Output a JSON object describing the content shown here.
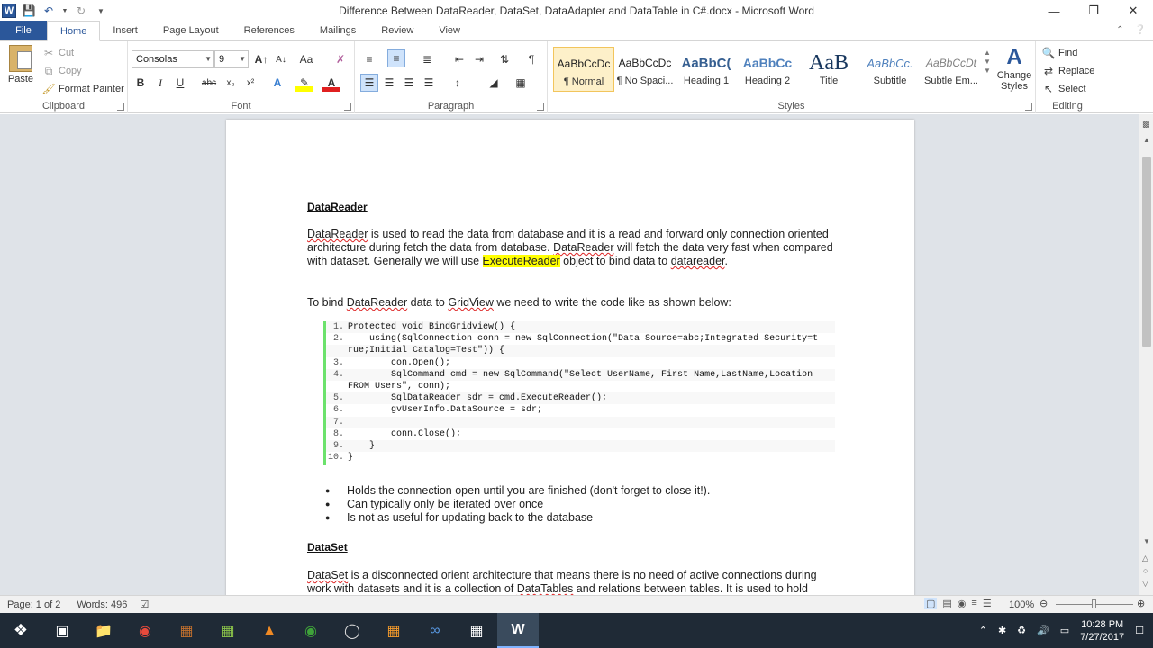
{
  "window": {
    "title": "Difference Between DataReader, DataSet, DataAdapter and DataTable in C#.docx - Microsoft Word"
  },
  "tabs": [
    {
      "label": "File"
    },
    {
      "label": "Home"
    },
    {
      "label": "Insert"
    },
    {
      "label": "Page Layout"
    },
    {
      "label": "References"
    },
    {
      "label": "Mailings"
    },
    {
      "label": "Review"
    },
    {
      "label": "View"
    }
  ],
  "clipboard": {
    "paste": "Paste",
    "cut": "Cut",
    "copy": "Copy",
    "format_painter": "Format Painter",
    "label": "Clipboard"
  },
  "font": {
    "family": "Consolas",
    "size": "9",
    "label": "Font"
  },
  "paragraph": {
    "label": "Paragraph"
  },
  "styles": {
    "items": [
      {
        "preview": "AaBbCcDc",
        "name": "¶ Normal"
      },
      {
        "preview": "AaBbCcDc",
        "name": "¶ No Spaci..."
      },
      {
        "preview": "AaBbC(",
        "name": "Heading 1"
      },
      {
        "preview": "AaBbCc",
        "name": "Heading 2"
      },
      {
        "preview": "AaB",
        "name": "Title"
      },
      {
        "preview": "AaBbCc.",
        "name": "Subtitle"
      },
      {
        "preview": "AaBbCcDt",
        "name": "Subtle Em..."
      }
    ],
    "change_styles": "Change Styles",
    "label": "Styles"
  },
  "editing": {
    "find": "Find",
    "replace": "Replace",
    "select": "Select",
    "label": "Editing"
  },
  "document": {
    "heading1": "DataReader",
    "para1_a": "DataReader",
    "para1_b": " is used to read the data from database and it is a read and forward only connection oriented architecture during fetch the data from database. ",
    "para1_c": "DataReader",
    "para1_d": " will fetch the data very fast when compared with dataset. Generally we will use ",
    "para1_e": "ExecuteReader",
    "para1_f": " object to bind data to ",
    "para1_g": "datareader",
    "para1_h": ".",
    "para2_a": "To bind ",
    "para2_b": "DataReader",
    "para2_c": " data to ",
    "para2_d": "GridView",
    "para2_e": " we need to write the code like as shown below:",
    "code": [
      {
        "n": "1.",
        "t": "Protected void BindGridview() {"
      },
      {
        "n": "2.",
        "t": "    using(SqlConnection conn = new SqlConnection(\"Data Source=abc;Integrated Security=t"
      },
      {
        "n": "",
        "t": "rue;Initial Catalog=Test\")) {"
      },
      {
        "n": "3.",
        "t": "        con.Open();"
      },
      {
        "n": "4.",
        "t": "        SqlCommand cmd = new SqlCommand(\"Select UserName, First Name,LastName,Location"
      },
      {
        "n": "",
        "t": "FROM Users\", conn);"
      },
      {
        "n": "5.",
        "t": "        SqlDataReader sdr = cmd.ExecuteReader();"
      },
      {
        "n": "6.",
        "t": "        gvUserInfo.DataSource = sdr;"
      },
      {
        "n": "7.",
        "t": ""
      },
      {
        "n": "8.",
        "t": "        conn.Close();"
      },
      {
        "n": "9.",
        "t": "    }"
      },
      {
        "n": "10.",
        "t": "}"
      }
    ],
    "bullets": [
      "Holds the connection open until you are finished (don't forget to close it!).",
      "Can typically only be iterated over once",
      "Is not as useful for updating back to the database"
    ],
    "heading2": "DataSet",
    "para3_a": "DataSet",
    "para3_b": " is a disconnected orient architecture that means there is no need of active connections during work with datasets and it is a collection of ",
    "para3_c": "DataTables",
    "para3_d": " and relations between tables. It is used to hold multiple tables with data. You can select data form tables, create views based on table and"
  },
  "status": {
    "page": "Page: 1 of 2",
    "words": "Words: 496",
    "zoom": "100%"
  },
  "taskbar": {
    "time": "10:28 PM",
    "date": "7/27/2017"
  }
}
